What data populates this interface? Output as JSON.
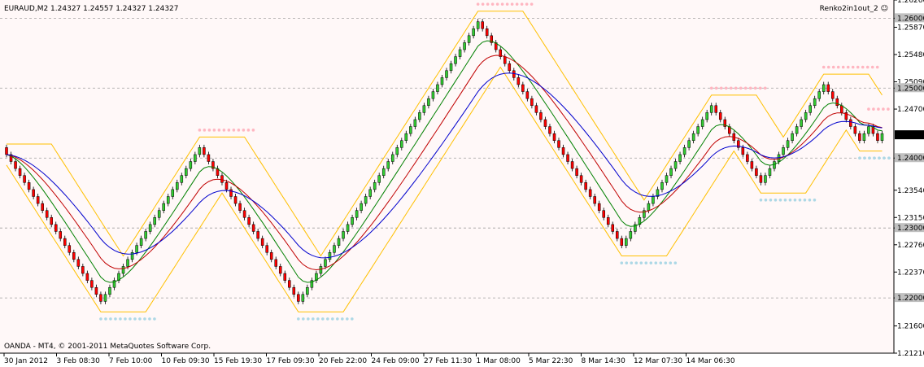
{
  "header": {
    "symbol_info": "EURAUD,M2  1.24327 1.24557 1.24327 1.24327",
    "indicator_name": "Renko2in1out_2 ☺"
  },
  "footer": {
    "copyright": "OANDA - MT4, © 2001-2011 MetaQuotes Software Corp."
  },
  "current_price": "1.24327",
  "colors": {
    "background": "#FFF8F8",
    "up": "#32CD32",
    "down": "#FF0000",
    "red_ma": "#C00000",
    "green_ma": "#008000",
    "blue_ma": "#0000CD",
    "band": "#FFC000",
    "pink_dots": "#FFB6C1",
    "blue_dots": "#ADD8E6",
    "grid": "#A0A0A0"
  },
  "chart_data": {
    "type": "candlestick",
    "y_ticks": [
      "1.26260",
      "1.26000",
      "1.25870",
      "1.25480",
      "1.25090",
      "1.25000",
      "1.24700",
      "1.24000",
      "1.23540",
      "1.23150",
      "1.23000",
      "1.22760",
      "1.22370",
      "1.22000",
      "1.21600",
      "1.21210"
    ],
    "grid_levels": [
      1.26,
      1.25,
      1.24,
      1.23,
      1.22
    ],
    "x_ticks": [
      "30 Jan 2012",
      "3 Feb 08:30",
      "7 Feb 10:00",
      "10 Feb 09:30",
      "15 Feb 19:30",
      "17 Feb 09:30",
      "20 Feb 22:00",
      "24 Feb 09:00",
      "27 Feb 11:30",
      "1 Mar 08:00",
      "5 Mar 22:30",
      "8 Mar 14:30",
      "12 Mar 07:30",
      "14 Mar 06:30"
    ],
    "ylim": [
      1.2121,
      1.2626
    ],
    "renko_bricks": [
      [
        "d",
        1.2405
      ],
      [
        "d",
        1.2395
      ],
      [
        "d",
        1.2385
      ],
      [
        "d",
        1.2375
      ],
      [
        "d",
        1.2365
      ],
      [
        "d",
        1.2355
      ],
      [
        "d",
        1.2345
      ],
      [
        "d",
        1.2335
      ],
      [
        "d",
        1.2325
      ],
      [
        "d",
        1.2315
      ],
      [
        "d",
        1.2305
      ],
      [
        "d",
        1.2295
      ],
      [
        "d",
        1.2285
      ],
      [
        "d",
        1.2275
      ],
      [
        "d",
        1.2265
      ],
      [
        "d",
        1.2255
      ],
      [
        "d",
        1.2245
      ],
      [
        "d",
        1.2235
      ],
      [
        "d",
        1.2225
      ],
      [
        "d",
        1.2215
      ],
      [
        "d",
        1.2205
      ],
      [
        "d",
        1.2195
      ],
      [
        "u",
        1.2205
      ],
      [
        "u",
        1.2215
      ],
      [
        "u",
        1.2225
      ],
      [
        "u",
        1.2235
      ],
      [
        "u",
        1.2245
      ],
      [
        "u",
        1.2255
      ],
      [
        "u",
        1.2265
      ],
      [
        "u",
        1.2275
      ],
      [
        "u",
        1.2285
      ],
      [
        "u",
        1.2295
      ],
      [
        "u",
        1.2305
      ],
      [
        "u",
        1.2315
      ],
      [
        "u",
        1.2325
      ],
      [
        "u",
        1.2335
      ],
      [
        "u",
        1.2345
      ],
      [
        "u",
        1.2355
      ],
      [
        "u",
        1.2365
      ],
      [
        "u",
        1.2375
      ],
      [
        "u",
        1.2385
      ],
      [
        "u",
        1.2395
      ],
      [
        "u",
        1.2405
      ],
      [
        "u",
        1.2415
      ],
      [
        "d",
        1.2405
      ],
      [
        "d",
        1.2395
      ],
      [
        "d",
        1.2385
      ],
      [
        "d",
        1.2375
      ],
      [
        "d",
        1.2365
      ],
      [
        "d",
        1.2355
      ],
      [
        "d",
        1.2345
      ],
      [
        "d",
        1.2335
      ],
      [
        "d",
        1.2325
      ],
      [
        "d",
        1.2315
      ],
      [
        "d",
        1.2305
      ],
      [
        "d",
        1.2295
      ],
      [
        "d",
        1.2285
      ],
      [
        "d",
        1.2275
      ],
      [
        "d",
        1.2265
      ],
      [
        "d",
        1.2255
      ],
      [
        "d",
        1.2245
      ],
      [
        "d",
        1.2235
      ],
      [
        "d",
        1.2225
      ],
      [
        "d",
        1.2215
      ],
      [
        "d",
        1.2205
      ],
      [
        "d",
        1.2195
      ],
      [
        "u",
        1.2205
      ],
      [
        "u",
        1.2215
      ],
      [
        "u",
        1.2225
      ],
      [
        "u",
        1.2235
      ],
      [
        "u",
        1.2245
      ],
      [
        "u",
        1.2255
      ],
      [
        "u",
        1.2265
      ],
      [
        "u",
        1.2275
      ],
      [
        "u",
        1.2285
      ],
      [
        "u",
        1.2295
      ],
      [
        "u",
        1.2305
      ],
      [
        "u",
        1.2315
      ],
      [
        "u",
        1.2325
      ],
      [
        "u",
        1.2335
      ],
      [
        "u",
        1.2345
      ],
      [
        "u",
        1.2355
      ],
      [
        "u",
        1.2365
      ],
      [
        "u",
        1.2375
      ],
      [
        "u",
        1.2385
      ],
      [
        "u",
        1.2395
      ],
      [
        "u",
        1.2405
      ],
      [
        "u",
        1.2415
      ],
      [
        "u",
        1.2425
      ],
      [
        "u",
        1.2435
      ],
      [
        "u",
        1.2445
      ],
      [
        "u",
        1.2455
      ],
      [
        "u",
        1.2465
      ],
      [
        "u",
        1.2475
      ],
      [
        "u",
        1.2485
      ],
      [
        "u",
        1.2495
      ],
      [
        "u",
        1.2505
      ],
      [
        "u",
        1.2515
      ],
      [
        "u",
        1.2525
      ],
      [
        "u",
        1.2535
      ],
      [
        "u",
        1.2545
      ],
      [
        "u",
        1.2555
      ],
      [
        "u",
        1.2565
      ],
      [
        "u",
        1.2575
      ],
      [
        "u",
        1.2585
      ],
      [
        "u",
        1.2595
      ],
      [
        "d",
        1.2585
      ],
      [
        "d",
        1.2575
      ],
      [
        "d",
        1.2565
      ],
      [
        "d",
        1.2555
      ],
      [
        "d",
        1.2545
      ],
      [
        "d",
        1.2535
      ],
      [
        "d",
        1.2525
      ],
      [
        "d",
        1.2515
      ],
      [
        "d",
        1.2505
      ],
      [
        "d",
        1.2495
      ],
      [
        "d",
        1.2485
      ],
      [
        "d",
        1.2475
      ],
      [
        "d",
        1.2465
      ],
      [
        "d",
        1.2455
      ],
      [
        "d",
        1.2445
      ],
      [
        "d",
        1.2435
      ],
      [
        "d",
        1.2425
      ],
      [
        "d",
        1.2415
      ],
      [
        "d",
        1.2405
      ],
      [
        "d",
        1.2395
      ],
      [
        "d",
        1.2385
      ],
      [
        "d",
        1.2375
      ],
      [
        "d",
        1.2365
      ],
      [
        "d",
        1.2355
      ],
      [
        "d",
        1.2345
      ],
      [
        "d",
        1.2335
      ],
      [
        "d",
        1.2325
      ],
      [
        "d",
        1.2315
      ],
      [
        "d",
        1.2305
      ],
      [
        "d",
        1.2295
      ],
      [
        "d",
        1.2285
      ],
      [
        "d",
        1.2275
      ],
      [
        "u",
        1.2285
      ],
      [
        "u",
        1.2295
      ],
      [
        "u",
        1.2305
      ],
      [
        "u",
        1.2315
      ],
      [
        "u",
        1.2325
      ],
      [
        "u",
        1.2335
      ],
      [
        "u",
        1.2345
      ],
      [
        "u",
        1.2355
      ],
      [
        "u",
        1.2365
      ],
      [
        "u",
        1.2375
      ],
      [
        "u",
        1.2385
      ],
      [
        "u",
        1.2395
      ],
      [
        "u",
        1.2405
      ],
      [
        "u",
        1.2415
      ],
      [
        "u",
        1.2425
      ],
      [
        "u",
        1.2435
      ],
      [
        "u",
        1.2445
      ],
      [
        "u",
        1.2455
      ],
      [
        "u",
        1.2465
      ],
      [
        "u",
        1.2475
      ],
      [
        "d",
        1.2465
      ],
      [
        "d",
        1.2455
      ],
      [
        "d",
        1.2445
      ],
      [
        "d",
        1.2435
      ],
      [
        "d",
        1.2425
      ],
      [
        "d",
        1.2415
      ],
      [
        "d",
        1.2405
      ],
      [
        "d",
        1.2395
      ],
      [
        "d",
        1.2385
      ],
      [
        "d",
        1.2375
      ],
      [
        "d",
        1.2365
      ],
      [
        "u",
        1.2375
      ],
      [
        "u",
        1.2385
      ],
      [
        "u",
        1.2395
      ],
      [
        "u",
        1.2405
      ],
      [
        "u",
        1.2415
      ],
      [
        "u",
        1.2425
      ],
      [
        "u",
        1.2435
      ],
      [
        "u",
        1.2445
      ],
      [
        "u",
        1.2455
      ],
      [
        "u",
        1.2465
      ],
      [
        "u",
        1.2475
      ],
      [
        "u",
        1.2485
      ],
      [
        "u",
        1.2495
      ],
      [
        "u",
        1.2505
      ],
      [
        "d",
        1.2495
      ],
      [
        "d",
        1.2485
      ],
      [
        "d",
        1.2475
      ],
      [
        "d",
        1.2465
      ],
      [
        "d",
        1.2455
      ],
      [
        "d",
        1.2445
      ],
      [
        "d",
        1.2435
      ],
      [
        "d",
        1.2425
      ],
      [
        "u",
        1.2435
      ],
      [
        "u",
        1.2445
      ],
      [
        "d",
        1.2435
      ],
      [
        "d",
        1.2425
      ],
      [
        "u",
        1.2435
      ]
    ]
  }
}
